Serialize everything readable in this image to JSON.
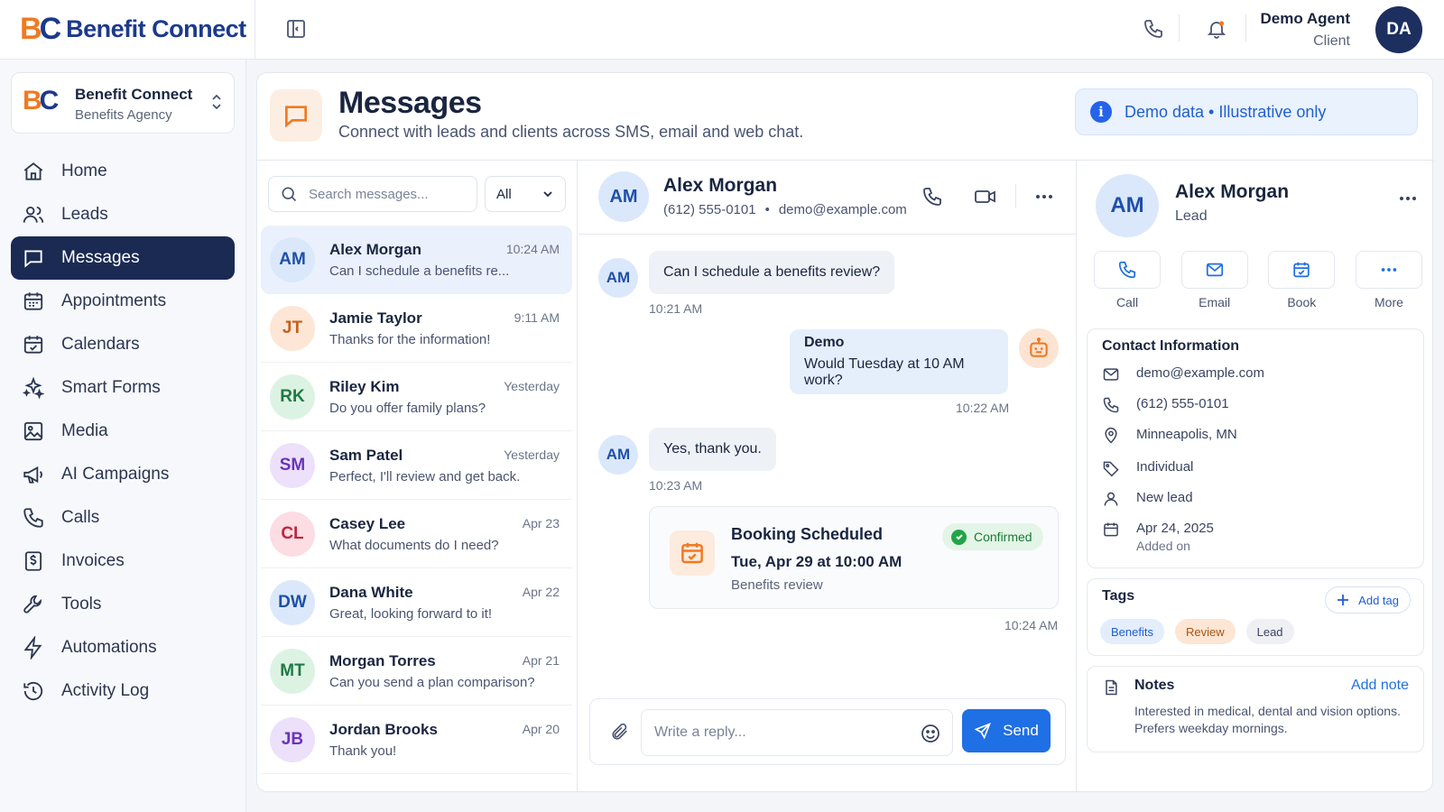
{
  "colors": {
    "brand_orange": "#f07a22",
    "brand_navy": "#1c3a8c",
    "accent_blue": "#1f6fe5",
    "nav_active": "#1b2a52"
  },
  "brand": {
    "logo_b": "B",
    "logo_c": "C",
    "name": "Benefit Connect"
  },
  "user": {
    "name": "Demo Agent",
    "role": "Client",
    "initials": "DA"
  },
  "org": {
    "name": "Benefit Connect",
    "subtitle": "Benefits Agency"
  },
  "nav": [
    {
      "label": "Home",
      "icon": "home-icon"
    },
    {
      "label": "Leads",
      "icon": "users-icon"
    },
    {
      "label": "Messages",
      "icon": "message-icon",
      "active": true
    },
    {
      "label": "Appointments",
      "icon": "appointments-icon"
    },
    {
      "label": "Calendars",
      "icon": "calendar-icon"
    },
    {
      "label": "Smart Forms",
      "icon": "sparkles-icon"
    },
    {
      "label": "Media",
      "icon": "image-icon"
    },
    {
      "label": "AI Campaigns",
      "icon": "megaphone-icon"
    },
    {
      "label": "Calls",
      "icon": "phone-icon"
    },
    {
      "label": "Invoices",
      "icon": "invoice-icon"
    },
    {
      "label": "Tools",
      "icon": "wrench-icon"
    },
    {
      "label": "Automations",
      "icon": "bolt-icon"
    },
    {
      "label": "Activity Log",
      "icon": "history-icon"
    }
  ],
  "page": {
    "title": "Messages",
    "subtitle": "Connect with leads and clients across SMS, email and web chat.",
    "demo_banner": "Demo data • Illustrative only",
    "info_glyph": "i"
  },
  "list": {
    "search_placeholder": "Search messages...",
    "filter": "All",
    "conversations": [
      {
        "initials": "AM",
        "name": "Alex Morgan",
        "time": "10:24 AM",
        "preview": "Can I schedule a benefits re...",
        "bg": "#dbe8fb",
        "fg": "#1f4fa8"
      },
      {
        "initials": "JT",
        "name": "Jamie Taylor",
        "time": "9:11 AM",
        "preview": "Thanks for the information!",
        "bg": "#fde6d6",
        "fg": "#c0621f"
      },
      {
        "initials": "RK",
        "name": "Riley Kim",
        "time": "Yesterday",
        "preview": "Do you offer family plans?",
        "bg": "#dcf3e4",
        "fg": "#1f7a43"
      },
      {
        "initials": "SM",
        "name": "Sam Patel",
        "time": "Yesterday",
        "preview": "Perfect, I'll review and get back.",
        "bg": "#ece0fb",
        "fg": "#6a34b8"
      },
      {
        "initials": "CL",
        "name": "Casey Lee",
        "time": "Apr 23",
        "preview": "What documents do I need?",
        "bg": "#fbdde3",
        "fg": "#c0243f"
      },
      {
        "initials": "DW",
        "name": "Dana White",
        "time": "Apr 22",
        "preview": "Great, looking forward to it!",
        "bg": "#dbe8fb",
        "fg": "#1f4fa8"
      },
      {
        "initials": "MT",
        "name": "Morgan Torres",
        "time": "Apr 21",
        "preview": "Can you send a plan comparison?",
        "bg": "#dcf3e4",
        "fg": "#1f7a43"
      },
      {
        "initials": "JB",
        "name": "Jordan Brooks",
        "time": "Apr 20",
        "preview": "Thank you!",
        "bg": "#ece0fb",
        "fg": "#6a34b8"
      }
    ]
  },
  "chat": {
    "initials": "AM",
    "name": "Alex Morgan",
    "phone": "(612) 555-0101",
    "separator": "•",
    "email": "demo@example.com",
    "messages": [
      {
        "dir": "in",
        "text": "Can I schedule a benefits review?",
        "time": "10:21 AM"
      },
      {
        "dir": "out",
        "sender": "Demo",
        "text": "Would Tuesday at 10 AM work?",
        "time": "10:22 AM"
      },
      {
        "dir": "in",
        "text": "Yes, thank you.",
        "time": "10:23 AM"
      }
    ],
    "booking": {
      "title": "Booking Scheduled",
      "when": "Tue, Apr 29 at 10:00 AM",
      "desc": "Benefits review",
      "status": "Confirmed",
      "time": "10:24 AM"
    },
    "reply_placeholder": "Write a reply...",
    "send_label": "Send"
  },
  "contact": {
    "initials": "AM",
    "name": "Alex Morgan",
    "status": "Lead",
    "actions": [
      "Call",
      "Email",
      "Book",
      "More"
    ],
    "info_title": "Contact Information",
    "email": "demo@example.com",
    "phone": "(612) 555-0101",
    "location": "Minneapolis, MN",
    "type": "Individual",
    "stage": "New lead",
    "added_date": "Apr 24, 2025",
    "added_label": "Added on",
    "tags_title": "Tags",
    "add_tag": "Add tag",
    "tags": [
      {
        "label": "Benefits",
        "bg": "#e3edfc",
        "fg": "#1f5fd1"
      },
      {
        "label": "Review",
        "bg": "#fde6d3",
        "fg": "#a65514"
      },
      {
        "label": "Lead",
        "bg": "#eef0f4",
        "fg": "#3a4460"
      }
    ],
    "notes_title": "Notes",
    "add_note": "Add note",
    "notes": "Interested in medical, dental and vision options. Prefers weekday mornings."
  }
}
